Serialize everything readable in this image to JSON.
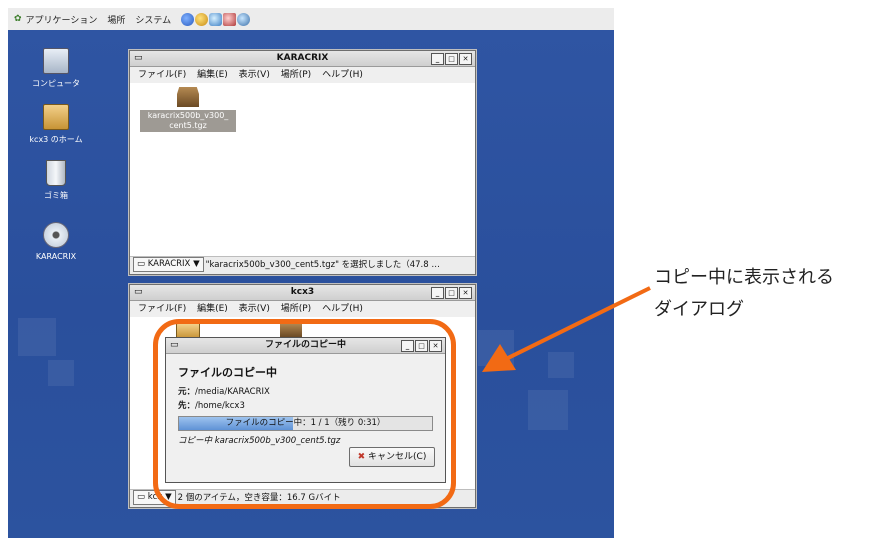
{
  "panel": {
    "menus": [
      "アプリケーション",
      "場所",
      "システム"
    ]
  },
  "desktop": {
    "icons": [
      {
        "label": "コンピュータ"
      },
      {
        "label": "kcx3 のホーム"
      },
      {
        "label": "ゴミ箱"
      },
      {
        "label": "KARACRIX"
      }
    ]
  },
  "window1": {
    "title": "KARACRIX",
    "menus": [
      "ファイル(F)",
      "編集(E)",
      "表示(V)",
      "場所(P)",
      "ヘルプ(H)"
    ],
    "file_label_line1": "karacrix500b_v300_",
    "file_label_line2": "cent5.tgz",
    "status_path": "KARACRIX",
    "status_text": "\"karacrix500b_v300_cent5.tgz\" を選択しました（47.8 …"
  },
  "window2": {
    "title": "kcx3",
    "menus": [
      "ファイル(F)",
      "編集(E)",
      "表示(V)",
      "場所(P)",
      "ヘルプ(H)"
    ],
    "status_path": "kcx",
    "status_text": "2 個のアイテム，空き容量：16.7 Gバイト"
  },
  "dialog": {
    "title": "ファイルのコピー中",
    "heading": "ファイルのコピー中",
    "from_label": "元：",
    "from_value": "/media/KARACRIX",
    "to_label": "先：",
    "to_value": "/home/kcx3",
    "progress_text": "ファイルのコピー中：1 / 1（残り 0:31）",
    "progress_fraction": 0.45,
    "copying_text": "コピー中 karacrix500b_v300_cent5.tgz",
    "cancel_label": "キャンセル(C)"
  },
  "annotation": {
    "line1": "コピー中に表示される",
    "line2": "ダイアログ"
  },
  "colors": {
    "desktop": "#2c539f",
    "accent_orange": "#f26a14",
    "progress": "#5f92d6"
  }
}
